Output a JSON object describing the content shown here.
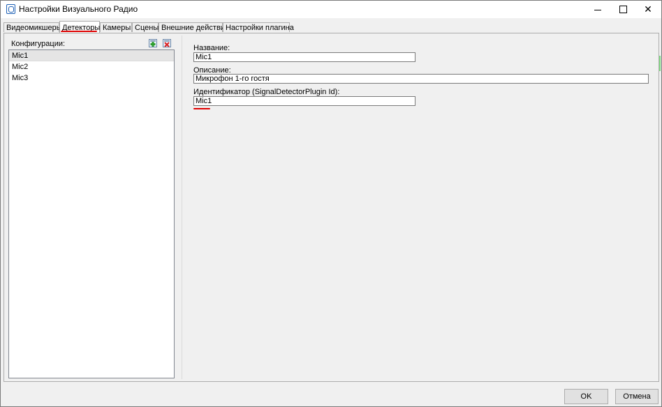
{
  "window": {
    "title": "Настройки Визуального Радио",
    "minimize_icon": "minimize-icon",
    "maximize_icon": "maximize-icon",
    "close_icon": "close-icon",
    "close_glyph": "✕"
  },
  "tabs": [
    {
      "label": "Видеомикшеры"
    },
    {
      "label": "Детекторы"
    },
    {
      "label": "Камеры"
    },
    {
      "label": "Сцены"
    },
    {
      "label": "Внешние действия"
    },
    {
      "label": "Настройки плагина"
    }
  ],
  "active_tab": "Детекторы",
  "configs": {
    "label": "Конфигурации:",
    "add_icon": "add-config-icon",
    "delete_icon": "delete-config-icon",
    "items": [
      {
        "label": "Mic1"
      },
      {
        "label": "Mic2"
      },
      {
        "label": "Mic3"
      }
    ],
    "selected": "Mic1"
  },
  "form": {
    "name_label": "Название:",
    "name_value": "Mic1",
    "description_label": "Описание:",
    "description_value": "Микрофон 1-го гостя",
    "id_label": "Идентификатор (SignalDetectorPlugin Id):",
    "id_value": "Mic1"
  },
  "footer": {
    "ok_label": "OK",
    "cancel_label": "Отмена"
  },
  "colors": {
    "annotation_underline": "#e00000",
    "selection": "#e5e5e5",
    "window_bg": "#f0f0f0"
  }
}
